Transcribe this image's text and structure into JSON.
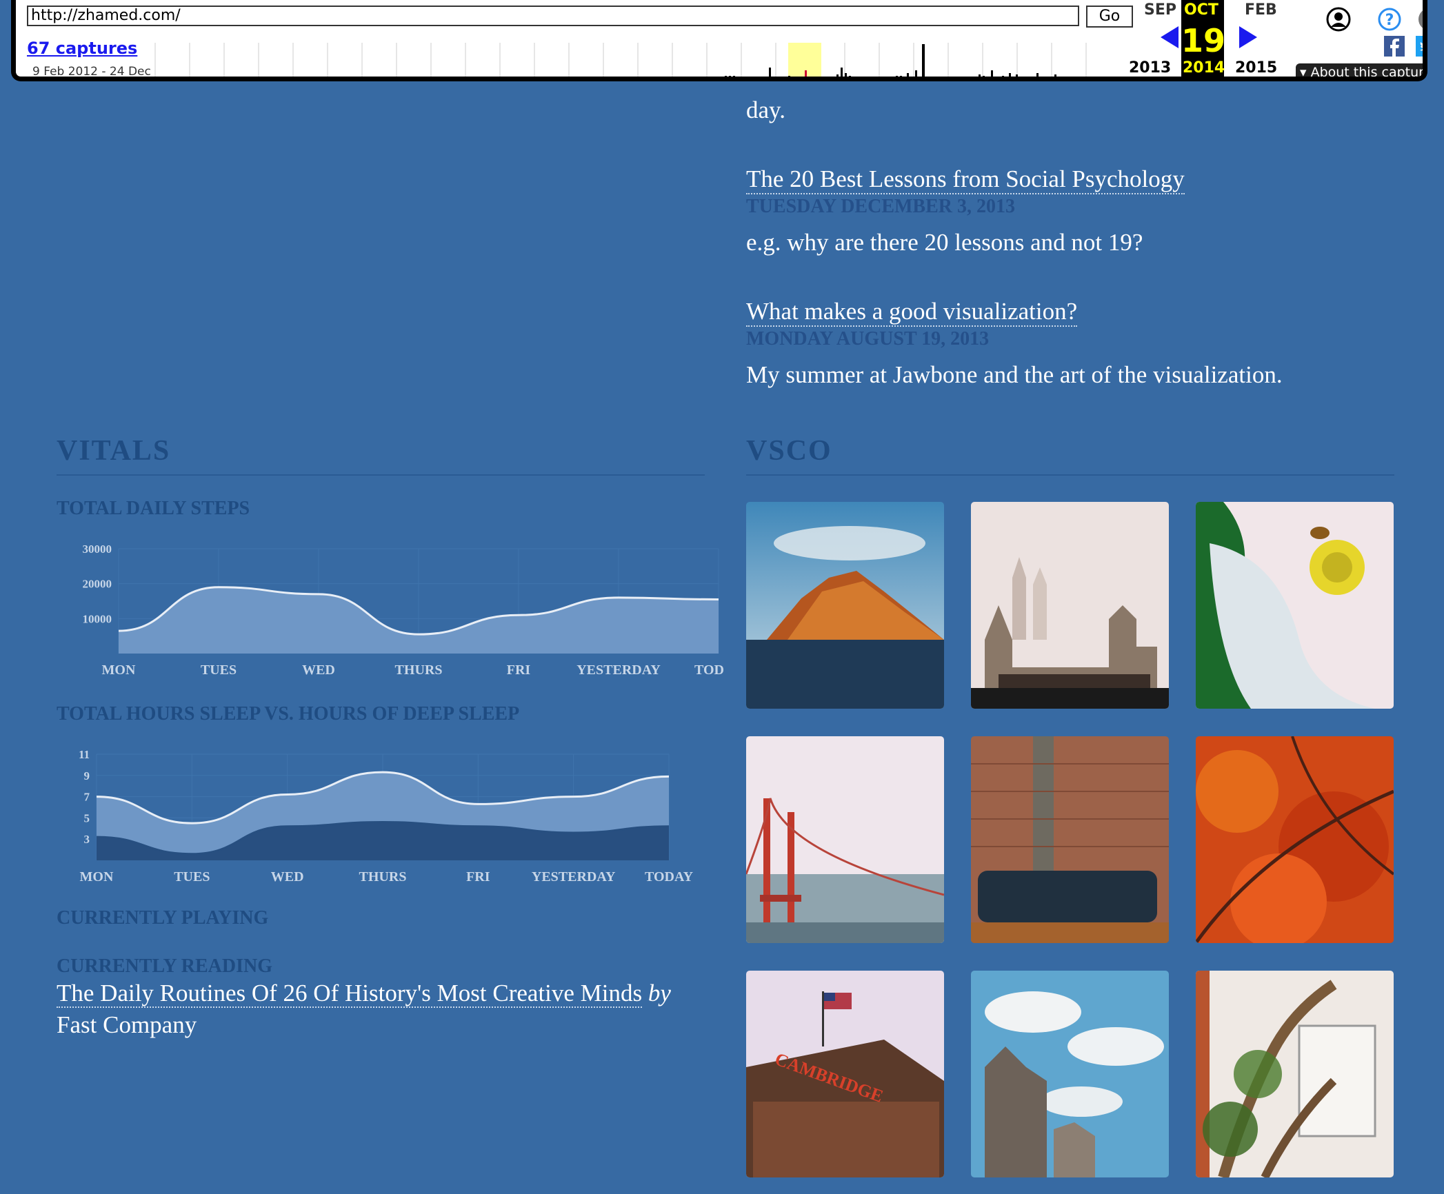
{
  "wayback": {
    "url": "http://zhamed.com/",
    "go_label": "Go",
    "captures_label": "67 captures",
    "range_label": "9 Feb 2012 - 24 Dec",
    "prev_month": "SEP",
    "cur_month": "OCT",
    "next_month": "FEB",
    "cur_day": "19",
    "prev_year": "2013",
    "cur_year": "2014",
    "next_year": "2015",
    "about_label": "About this capture"
  },
  "blog": {
    "fragment": "day.",
    "posts": [
      {
        "title": "The 20 Best Lessons from Social Psychology",
        "date": "TUESDAY DECEMBER 3, 2013",
        "summary": "e.g. why are there 20 lessons and not 19?"
      },
      {
        "title": "What makes a good visualization?",
        "date": "MONDAY AUGUST 19, 2013",
        "summary": "My summer at Jawbone and the art of the visualization."
      }
    ]
  },
  "vitals": {
    "heading": "VITALS",
    "steps_heading": "TOTAL DAILY STEPS",
    "sleep_heading": "TOTAL HOURS SLEEP VS. HOURS OF DEEP SLEEP",
    "playing_heading": "CURRENTLY PLAYING",
    "reading_heading": "CURRENTLY READING",
    "reading_title": "The Daily Routines Of 26 Of History's Most Creative Minds",
    "reading_by": "by",
    "reading_source": "Fast Company"
  },
  "vsco": {
    "heading": "VSCO",
    "photos": [
      "coastal-cliff",
      "foggy-cathedral",
      "flower-with-bee",
      "golden-gate-fog",
      "brick-wall-sofa",
      "red-autumn-leaves",
      "cambridge-savings-bank",
      "building-under-clouds",
      "ivy-tree-window"
    ]
  },
  "chart_data": [
    {
      "type": "area",
      "title": "TOTAL DAILY STEPS",
      "categories": [
        "MON",
        "TUES",
        "WED",
        "THURS",
        "FRI",
        "YESTERDAY",
        "TODAY"
      ],
      "series": [
        {
          "values": [
            6500,
            19000,
            17000,
            5500,
            11000,
            16000,
            15500
          ]
        }
      ],
      "yticks": [
        10000,
        20000,
        30000
      ],
      "ylim": [
        0,
        30000
      ]
    },
    {
      "type": "area",
      "title": "TOTAL HOURS SLEEP VS. HOURS OF DEEP SLEEP",
      "categories": [
        "MON",
        "TUES",
        "WED",
        "THURS",
        "FRI",
        "YESTERDAY",
        "TODAY"
      ],
      "series": [
        {
          "values": [
            7.0,
            4.5,
            7.2,
            9.3,
            6.3,
            7.0,
            8.9
          ]
        },
        {
          "values": [
            3.2,
            1.6,
            4.2,
            4.6,
            4.2,
            3.6,
            4.2
          ]
        }
      ],
      "yticks": [
        3,
        5,
        7,
        9,
        11
      ],
      "ylim": [
        1,
        11
      ]
    }
  ]
}
